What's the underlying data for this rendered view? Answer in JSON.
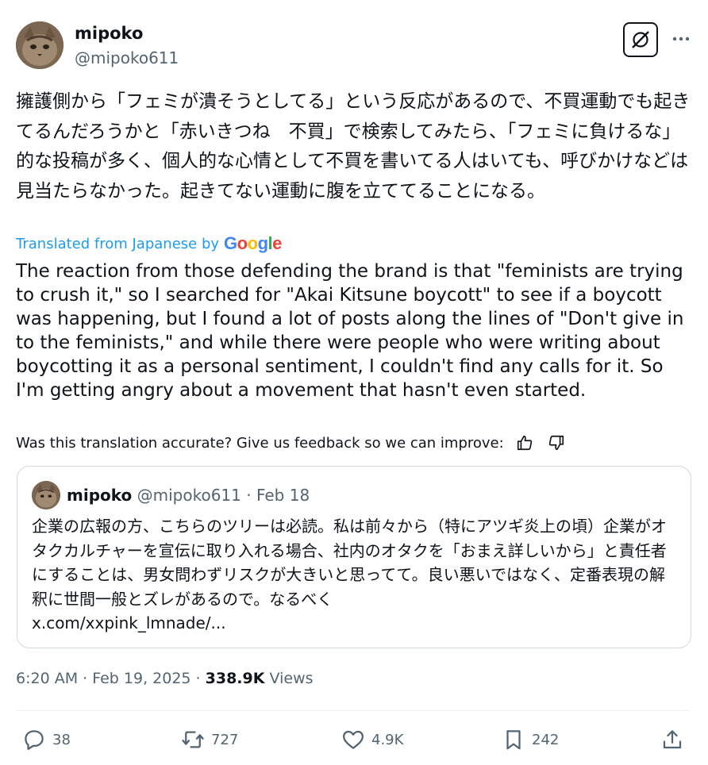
{
  "author": {
    "name": "mipoko",
    "handle": "@mipoko611"
  },
  "original_text": "擁護側から「フェミが潰そうとしてる」という反応があるので、不買運動でも起きてるんだろうかと「赤いきつね　不買」で検索してみたら、「フェミに負けるな」的な投稿が多く、個人的な心情として不買を書いてる人はいても、呼びかけなどは見当たらなかった。起きてない運動に腹を立ててることになる。",
  "translation": {
    "label": "Translated from Japanese by",
    "provider": "Google",
    "text": "The reaction from those defending the brand is that \"feminists are trying to crush it,\" so I searched for \"Akai Kitsune boycott\" to see if a boycott was happening, but I found a lot of posts along the lines of \"Don't give in to the feminists,\" and while there were people who were writing about boycotting it as a personal sentiment, I couldn't find any calls for it. So I'm getting angry about a movement that hasn't even started.",
    "feedback_prompt": "Was this translation accurate? Give us feedback so we can improve:"
  },
  "quoted_post": {
    "name": "mipoko",
    "handle": "@mipoko611",
    "date": "· Feb 18",
    "text": "企業の広報の方、こちらのツリーは必読。私は前々から（特にアツギ炎上の頃）企業がオタクカルチャーを宣伝に取り入れる場合、社内のオタクを「おまえ詳しいから」と責任者にすることは、男女問わずリスクが大きいと思ってて。良い悪いではなく、定番表現の解釈に世間一般とズレがあるので。なるべく",
    "link": "x.com/xxpink_lmnade/..."
  },
  "meta": {
    "time": "6:20 AM · Feb 19, 2025 ·",
    "views_count": "338.9K",
    "views_label": "Views"
  },
  "actions": {
    "replies": "38",
    "reposts": "727",
    "likes": "4.9K",
    "bookmarks": "242"
  },
  "icons": [
    "grok-icon",
    "more-icon",
    "thumbs-up-icon",
    "thumbs-down-icon",
    "reply-icon",
    "repost-icon",
    "like-icon",
    "bookmark-icon",
    "share-icon"
  ],
  "colors": {
    "link": "#1d9bf0",
    "secondary_text": "#536471",
    "primary_text": "#0f1419",
    "border": "#cfd9de"
  }
}
